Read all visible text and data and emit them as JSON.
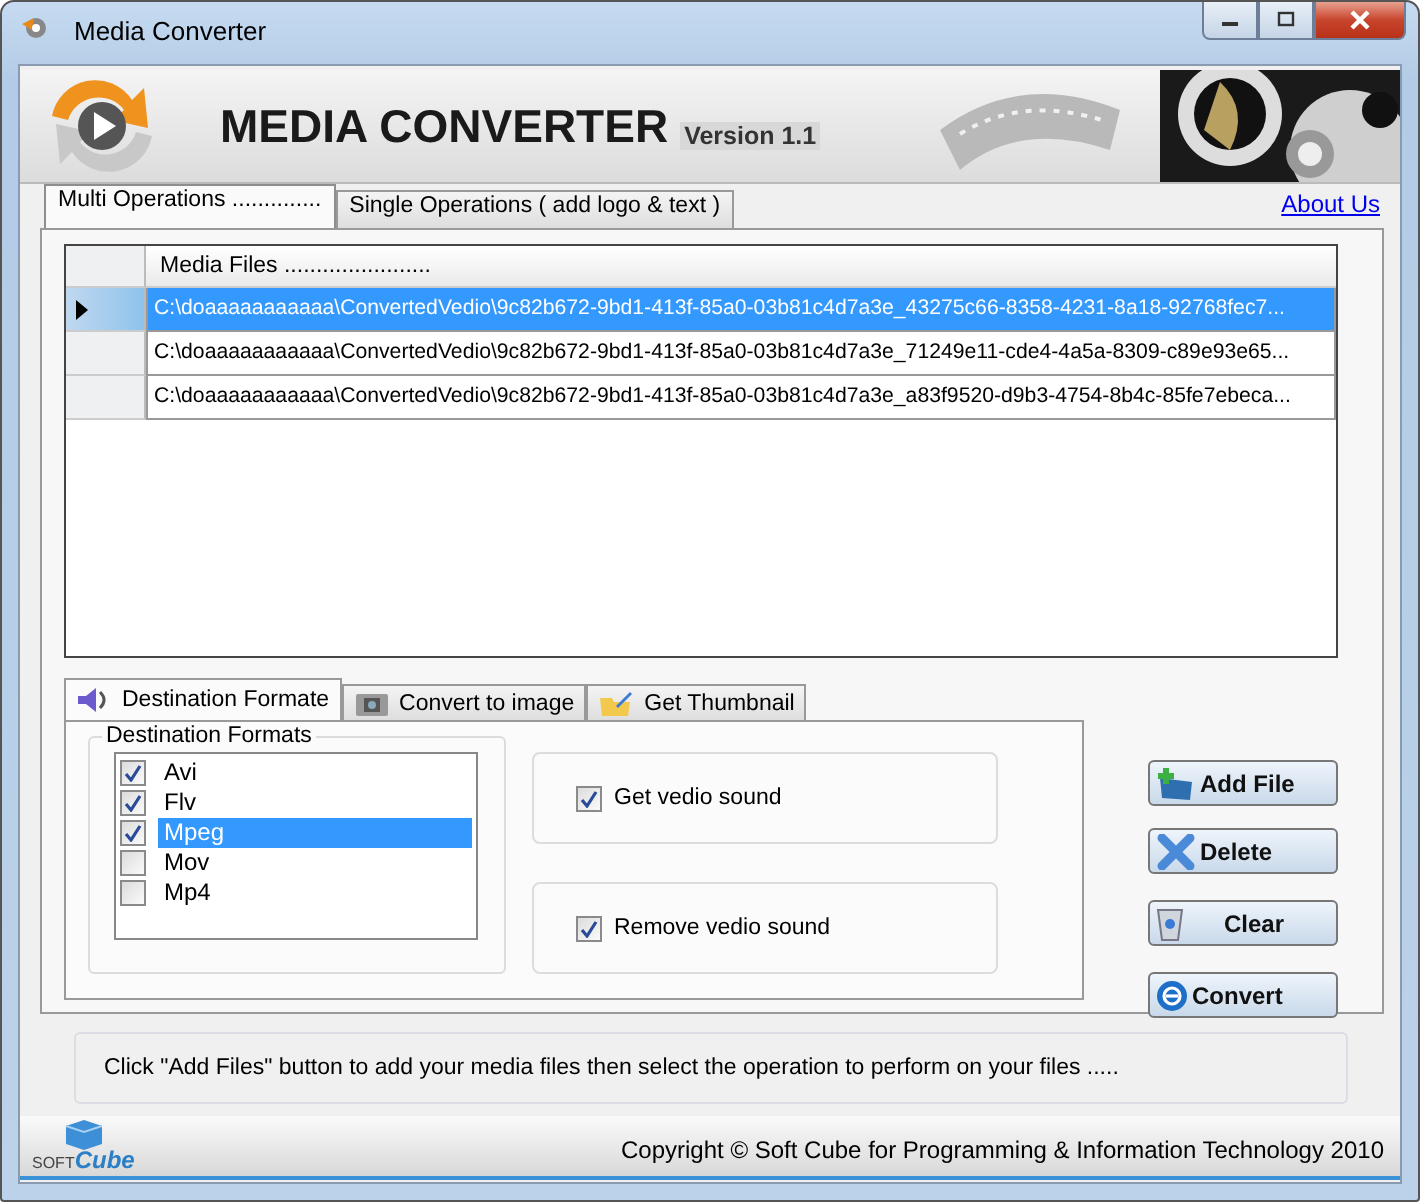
{
  "window": {
    "title": "Media Converter"
  },
  "banner": {
    "title": "MEDIA CONVERTER",
    "version": "Version 1.1"
  },
  "tabs": [
    {
      "label": "Multi Operations ..............",
      "selected": true
    },
    {
      "label": "Single Operations ( add logo & text  )",
      "selected": false
    }
  ],
  "about_link": "About Us",
  "table": {
    "columns": [
      "Media Files ......................."
    ],
    "rows": [
      {
        "path": "C:\\doaaaaaaaaaaa\\ConvertedVedio\\9c82b672-9bd1-413f-85a0-03b81c4d7a3e_43275c66-8358-4231-8a18-92768fec7...",
        "selected": true
      },
      {
        "path": "C:\\doaaaaaaaaaaa\\ConvertedVedio\\9c82b672-9bd1-413f-85a0-03b81c4d7a3e_71249e11-cde4-4a5a-8309-c89e93e65...",
        "selected": false
      },
      {
        "path": "C:\\doaaaaaaaaaaa\\ConvertedVedio\\9c82b672-9bd1-413f-85a0-03b81c4d7a3e_a83f9520-d9b3-4754-8b4c-85fe7ebeca...",
        "selected": false
      }
    ]
  },
  "sub_tabs": [
    {
      "label": "Destination Formate",
      "kind": "sound",
      "selected": true
    },
    {
      "label": "Convert to image",
      "kind": "image",
      "selected": false
    },
    {
      "label": "Get Thumbnail",
      "kind": "thumbnail",
      "selected": false
    }
  ],
  "formats": {
    "title": "Destination Formats",
    "items": [
      {
        "label": "Avi",
        "checked": true,
        "selected": false
      },
      {
        "label": "Flv",
        "checked": true,
        "selected": false
      },
      {
        "label": "Mpeg",
        "checked": true,
        "selected": true
      },
      {
        "label": "Mov",
        "checked": false,
        "selected": false
      },
      {
        "label": "Mp4",
        "checked": false,
        "selected": false
      }
    ]
  },
  "options": [
    {
      "label": "Get vedio sound",
      "checked": true
    },
    {
      "label": "Remove vedio sound",
      "checked": true
    }
  ],
  "buttons": [
    {
      "label": "Add File",
      "kind": "add"
    },
    {
      "label": "Delete",
      "kind": "delete"
    },
    {
      "label": "Clear",
      "kind": "clear"
    },
    {
      "label": "Convert",
      "kind": "convert"
    }
  ],
  "hint": "Click \"Add Files\" button to add your media files  then select the operation to perform on your files    .....",
  "footer": {
    "logo_first": "SOFT",
    "logo_second": "Cube",
    "copyright": "Copyright © Soft Cube for Programming & Information Technology 2010"
  }
}
